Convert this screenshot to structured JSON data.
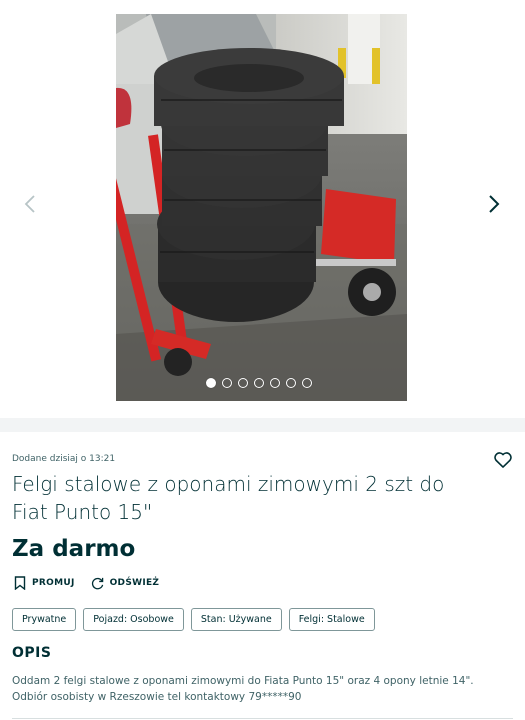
{
  "gallery": {
    "image_count": 7,
    "active_index": 0
  },
  "listing": {
    "posted": "Dodane dzisiaj o 13:21",
    "title": "Felgi stalowe z oponami zimowymi 2 szt do Fiat Punto 15\"",
    "price": "Za darmo"
  },
  "actions": {
    "promote": "PROMUJ",
    "refresh": "ODŚWIEŻ"
  },
  "tags": [
    "Prywatne",
    "Pojazd: Osobowe",
    "Stan: Używane",
    "Felgi: Stalowe"
  ],
  "description": {
    "heading": "OPIS",
    "text": "Oddam 2 felgi stalowe z oponami zimowymi do Fiata Punto 15\" oraz 4 opony letnie 14\". Odbiór osobisty w Rzeszowie tel kontaktowy 79*****90"
  },
  "icons": {
    "prev": "chevron-left-icon",
    "next": "chevron-right-icon",
    "expand": "expand-icon",
    "favorite": "heart-icon",
    "promote": "bookmark-icon",
    "refresh": "refresh-icon"
  },
  "colors": {
    "text": "#002f34",
    "muted": "#406367",
    "separator": "#f2f4f5",
    "tag_border": "#7f9799"
  }
}
